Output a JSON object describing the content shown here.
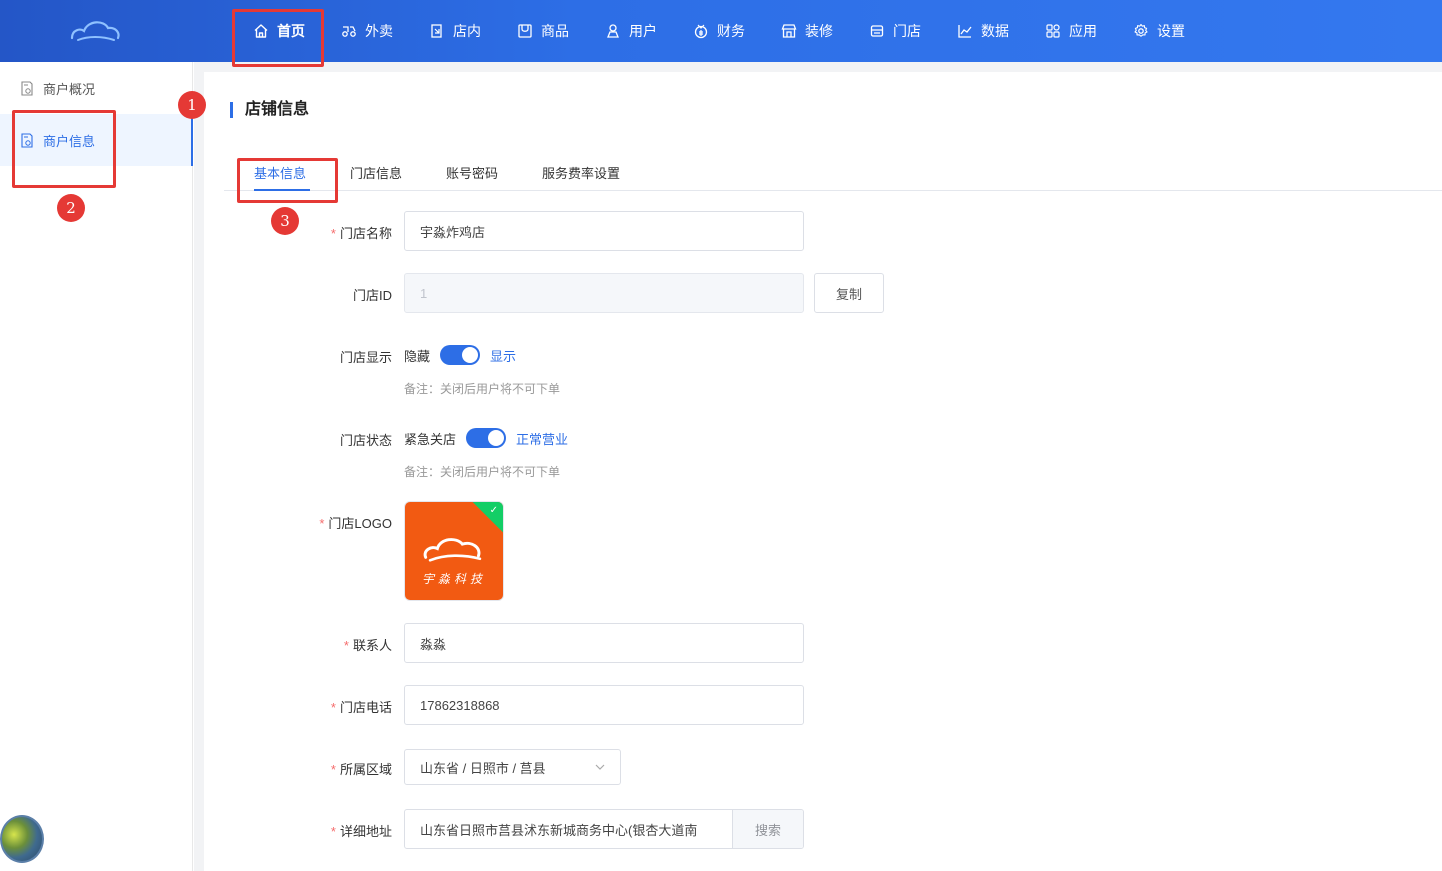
{
  "header": {
    "nav": [
      {
        "label": "首页",
        "icon": "home-icon",
        "active": true
      },
      {
        "label": "外卖",
        "icon": "delivery-icon"
      },
      {
        "label": "店内",
        "icon": "dine-in-icon"
      },
      {
        "label": "商品",
        "icon": "product-icon"
      },
      {
        "label": "用户",
        "icon": "user-icon"
      },
      {
        "label": "财务",
        "icon": "finance-icon"
      },
      {
        "label": "装修",
        "icon": "decor-icon"
      },
      {
        "label": "门店",
        "icon": "store-icon"
      },
      {
        "label": "数据",
        "icon": "chart-icon"
      },
      {
        "label": "应用",
        "icon": "apps-icon"
      },
      {
        "label": "设置",
        "icon": "gear-icon"
      }
    ]
  },
  "sidebar": {
    "items": [
      {
        "label": "商户概况"
      },
      {
        "label": "商户信息",
        "active": true
      }
    ]
  },
  "page": {
    "title": "店铺信息",
    "tabs": [
      "基本信息",
      "门店信息",
      "账号密码",
      "服务费率设置"
    ]
  },
  "form": {
    "store_name": {
      "label": "门店名称",
      "value": "宇淼炸鸡店"
    },
    "store_id": {
      "label": "门店ID",
      "value": "1",
      "copy_label": "复制"
    },
    "store_display": {
      "label": "门店显示",
      "off_label": "隐藏",
      "on_label": "显示",
      "enabled": true,
      "note": "备注：关闭后用户将不可下单"
    },
    "store_status": {
      "label": "门店状态",
      "off_label": "紧急关店",
      "on_label": "正常营业",
      "enabled": true,
      "note": "备注：关闭后用户将不可下单"
    },
    "store_logo": {
      "label": "门店LOGO",
      "logo_text": "宇淼科技"
    },
    "contact": {
      "label": "联系人",
      "value": "淼淼"
    },
    "phone": {
      "label": "门店电话",
      "value": "17862318868"
    },
    "region": {
      "label": "所属区域",
      "value": "山东省 / 日照市 / 莒县"
    },
    "address": {
      "label": "详细地址",
      "value": "山东省日照市莒县沭东新城商务中心(银杏大道南",
      "search_label": "搜索"
    }
  },
  "annotations": [
    "1",
    "2",
    "3"
  ],
  "colors": {
    "primary": "#2d6ee6",
    "danger": "#e53935",
    "required": "#f56c6c",
    "logo_bg": "#f25a12"
  }
}
